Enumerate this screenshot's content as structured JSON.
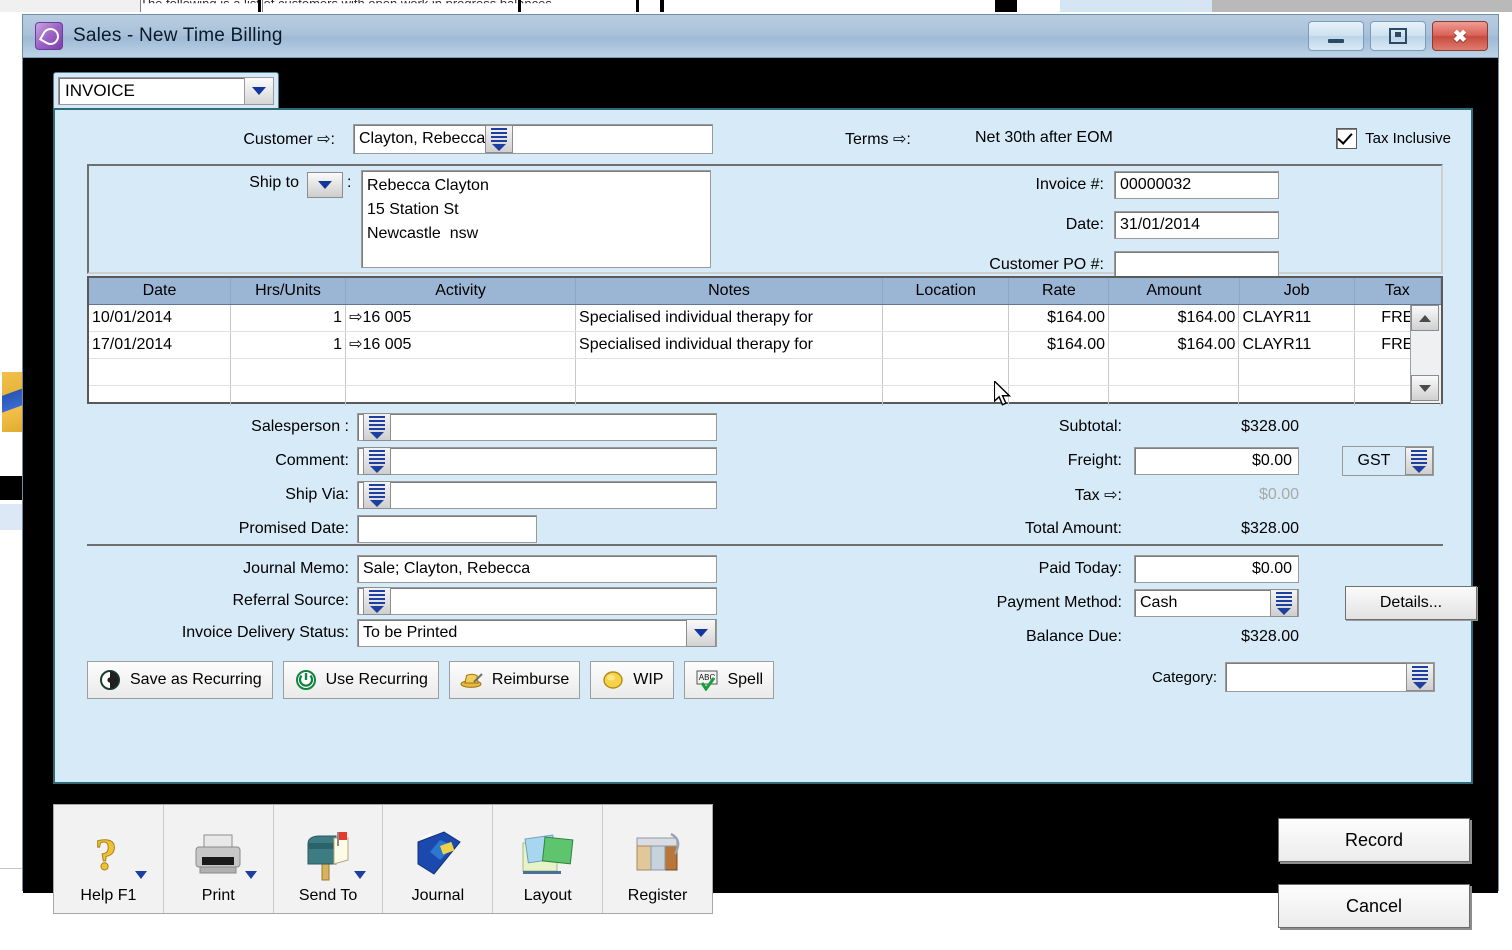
{
  "background": {
    "clipped_text": "The following is a list of customers with open work in progress balances."
  },
  "window": {
    "title": "Sales - New Time Billing",
    "icon": "sales-window-icon",
    "minimize_label": "Minimize",
    "maximize_label": "Maximize",
    "close_label": "Close"
  },
  "doc_type": {
    "value": "INVOICE"
  },
  "header": {
    "customer_label": "Customer",
    "customer_arrow": "⇨",
    "customer_colon": ":",
    "customer_value": "Clayton, Rebecca",
    "terms_label": "Terms",
    "terms_arrow": "⇨",
    "terms_colon": ":",
    "terms_value": "Net 30th after EOM",
    "tax_inclusive_label": "Tax Inclusive",
    "tax_inclusive_checked": true
  },
  "ship": {
    "label": "Ship to",
    "colon": ":",
    "address": "Rebecca Clayton\n15 Station St\nNewcastle  nsw"
  },
  "invoice": {
    "rows": [
      {
        "label": "Invoice #:",
        "value": "00000032"
      },
      {
        "label": "Date:",
        "value": "31/01/2014"
      },
      {
        "label": "Customer PO #:",
        "value": ""
      }
    ]
  },
  "grid": {
    "columns": [
      "Date",
      "Hrs/Units",
      "Activity",
      "Notes",
      "Location",
      "Rate",
      "Amount",
      "Job",
      "Tax"
    ],
    "rows": [
      {
        "date": "10/01/2014",
        "hrs": "1",
        "activity": "⇨16 005",
        "notes": "Specialised individual therapy for",
        "location": "",
        "rate": "$164.00",
        "amount": "$164.00",
        "job": "CLAYR11",
        "tax": "FRE"
      },
      {
        "date": "17/01/2014",
        "hrs": "1",
        "activity": "⇨16 005",
        "notes": "Specialised individual therapy for",
        "location": "",
        "rate": "$164.00",
        "amount": "$164.00",
        "job": "CLAYR11",
        "tax": "FRE"
      },
      {
        "date": "",
        "hrs": "",
        "activity": "",
        "notes": "",
        "location": "",
        "rate": "",
        "amount": "",
        "job": "",
        "tax": ""
      },
      {
        "date": "",
        "hrs": "",
        "activity": "",
        "notes": "",
        "location": "",
        "rate": "",
        "amount": "",
        "job": "",
        "tax": ""
      }
    ]
  },
  "mid_left": {
    "rows": [
      {
        "label": "Salesperson   :",
        "value": "",
        "lookup": true
      },
      {
        "label": "Comment:",
        "value": "",
        "lookup": true
      },
      {
        "label": "Ship Via:",
        "value": "",
        "lookup": true
      },
      {
        "label": "Promised Date:",
        "value": "",
        "lookup": false
      }
    ]
  },
  "totals": {
    "subtotal_label": "Subtotal:",
    "subtotal_value": "$328.00",
    "freight_label": "Freight:",
    "freight_value": "$0.00",
    "tax_label": "Tax",
    "tax_arrow": "⇨",
    "tax_colon": ":",
    "tax_value": "$0.00",
    "total_label": "Total Amount:",
    "total_value": "$328.00",
    "gst_value": "GST"
  },
  "lower_left": {
    "memo_label": "Journal Memo:",
    "memo_value": "Sale; Clayton, Rebecca",
    "referral_label": "Referral Source:",
    "referral_value": "",
    "delivery_label": "Invoice Delivery Status:",
    "delivery_value": "To be Printed"
  },
  "lower_right": {
    "paid_label": "Paid Today:",
    "paid_value": "$0.00",
    "method_label": "Payment Method:",
    "method_value": "Cash",
    "balance_label": "Balance Due:",
    "balance_value": "$328.00",
    "details_label": "Details..."
  },
  "action_buttons": [
    {
      "label": "Save as Recurring",
      "icon": "recurring-clock-icon"
    },
    {
      "label": "Use Recurring",
      "icon": "power-refresh-icon"
    },
    {
      "label": "Reimburse",
      "icon": "reimburse-hat-icon"
    },
    {
      "label": "WIP",
      "icon": "wip-coin-icon"
    },
    {
      "label": "Spell",
      "icon": "spell-check-icon"
    }
  ],
  "category": {
    "label": "Category:",
    "value": ""
  },
  "toolbar": [
    {
      "label": "Help F1",
      "icon": "question-mark-icon",
      "has_caret": true
    },
    {
      "label": "Print",
      "icon": "printer-icon",
      "has_caret": true
    },
    {
      "label": "Send To",
      "icon": "mailbox-icon",
      "has_caret": true
    },
    {
      "label": "Journal",
      "icon": "journal-book-icon",
      "has_caret": false
    },
    {
      "label": "Layout",
      "icon": "layout-pages-icon",
      "has_caret": false
    },
    {
      "label": "Register",
      "icon": "register-binder-icon",
      "has_caret": false
    }
  ],
  "primary_buttons": {
    "record_label": "Record",
    "cancel_label": "Cancel"
  },
  "colors": {
    "panel_blue": "#d7eaf8",
    "grid_header_blue": "#9bb5d4",
    "titlebar_blue": "#a9c2da",
    "accent_blue": "#1c3fa0",
    "window_black": "#000000"
  }
}
